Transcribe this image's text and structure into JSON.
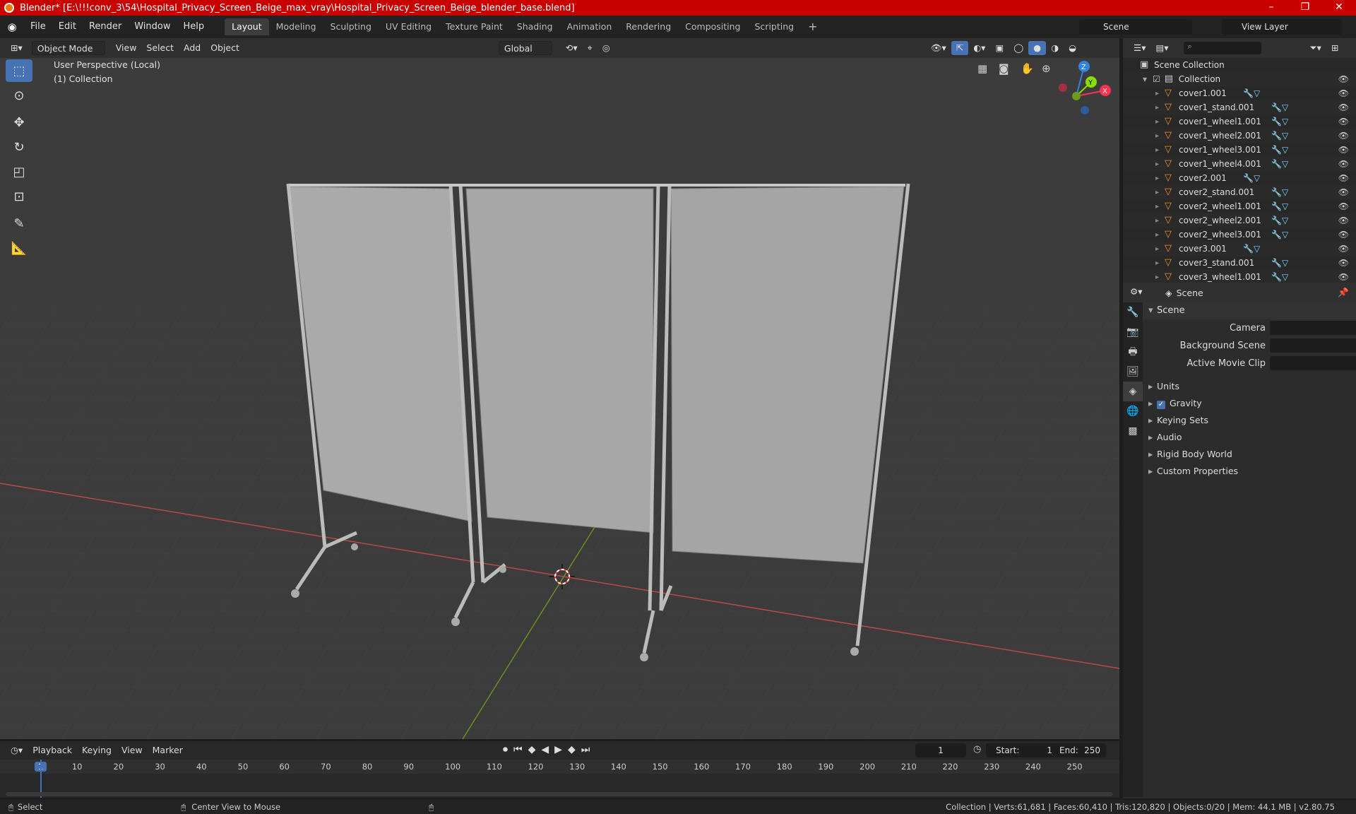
{
  "window": {
    "title": "Blender* [E:\\!!!conv_3\\54\\Hospital_Privacy_Screen_Beige_max_vray\\Hospital_Privacy_Screen_Beige_blender_base.blend]"
  },
  "menus": [
    "File",
    "Edit",
    "Render",
    "Window",
    "Help"
  ],
  "workspaces": [
    "Layout",
    "Modeling",
    "Sculpting",
    "UV Editing",
    "Texture Paint",
    "Shading",
    "Animation",
    "Rendering",
    "Compositing",
    "Scripting"
  ],
  "active_workspace": "Layout",
  "scene_selector": "Scene",
  "view_layer_selector": "View Layer",
  "viewport": {
    "mode": "Object Mode",
    "menus": [
      "View",
      "Select",
      "Add",
      "Object"
    ],
    "orientation": "Global",
    "perspective_label": "User Perspective (Local)",
    "collection_label": "(1) Collection",
    "gizmo": {
      "z": "Z",
      "y": "Y",
      "x": "X"
    }
  },
  "outliner": {
    "root": "Scene Collection",
    "collection": "Collection",
    "items": [
      "cover1.001",
      "cover1_stand.001",
      "cover1_wheel1.001",
      "cover1_wheel2.001",
      "cover1_wheel3.001",
      "cover1_wheel4.001",
      "cover2.001",
      "cover2_stand.001",
      "cover2_wheel1.001",
      "cover2_wheel2.001",
      "cover2_wheel3.001",
      "cover3.001",
      "cover3_stand.001",
      "cover3_wheel1.001"
    ]
  },
  "properties": {
    "header": "Scene",
    "section": "Scene",
    "fields": [
      "Camera",
      "Background Scene",
      "Active Movie Clip"
    ],
    "panels": [
      "Units",
      "Gravity",
      "Keying Sets",
      "Audio",
      "Rigid Body World",
      "Custom Properties"
    ],
    "gravity_checked": true
  },
  "timeline": {
    "menus": [
      "Playback",
      "Keying",
      "View",
      "Marker"
    ],
    "current_frame": "1",
    "start_label": "Start:",
    "start": "1",
    "end_label": "End:",
    "end": "250",
    "ticks": [
      "1",
      "10",
      "20",
      "30",
      "40",
      "50",
      "60",
      "70",
      "80",
      "90",
      "100",
      "110",
      "120",
      "130",
      "140",
      "150",
      "160",
      "170",
      "180",
      "190",
      "200",
      "210",
      "220",
      "230",
      "240",
      "250"
    ]
  },
  "status": {
    "left": "Select",
    "middle": "Center View to Mouse",
    "right": "Collection | Verts:61,681 | Faces:60,410 | Tris:120,820 | Objects:0/20 | Mem: 44.1 MB | v2.80.75"
  },
  "colors": {
    "accent": "#4772b3",
    "title_bar": "#c80000",
    "x_axis": "#ff3352",
    "y_axis": "#8bdc00",
    "z_axis": "#2f83e3",
    "object_icon": "#f0902a"
  }
}
